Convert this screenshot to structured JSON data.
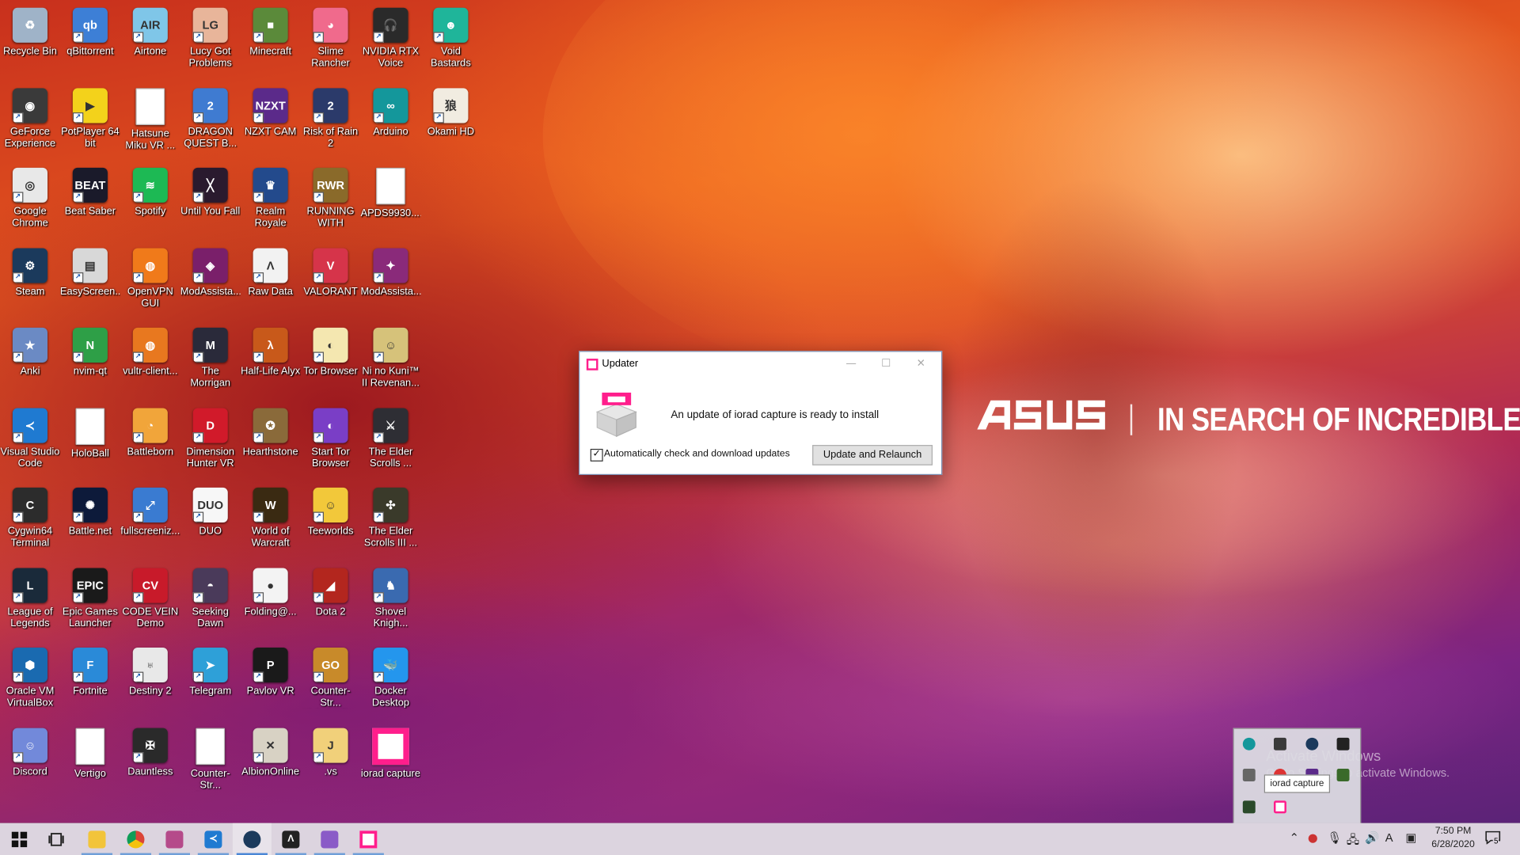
{
  "wallpaper": {
    "brand": "/ISUS",
    "slogan": "IN SEARCH OF INCREDIBLE"
  },
  "watermark": {
    "line1": "Activate Windows",
    "line2": "Go to Settings to activate Windows."
  },
  "desktop": {
    "icons": [
      {
        "label": "Recycle Bin",
        "icon": "recycle-bin-icon",
        "bg": "#9fb3c8",
        "glyph": "♻",
        "shortcut": false
      },
      {
        "label": "qBittorrent",
        "icon": "qbittorrent-icon",
        "bg": "#3d7fd6",
        "glyph": "qb",
        "shortcut": true
      },
      {
        "label": "Airtone",
        "icon": "airtone-icon",
        "bg": "#7fc6e8",
        "glyph": "AIR",
        "shortcut": true
      },
      {
        "label": "Lucy Got\nProblems",
        "icon": "lucy-got-problems-icon",
        "bg": "#e8b59a",
        "glyph": "LG",
        "shortcut": true
      },
      {
        "label": "Minecraft",
        "icon": "minecraft-icon",
        "bg": "#5b8a3a",
        "glyph": "■",
        "shortcut": true
      },
      {
        "label": "Slime\nRancher",
        "icon": "slime-rancher-icon",
        "bg": "#f06a8c",
        "glyph": "◕",
        "shortcut": true
      },
      {
        "label": "NVIDIA RTX\nVoice",
        "icon": "nvidia-rtx-voice-icon",
        "bg": "#2a2a2a",
        "glyph": "🎧",
        "shortcut": true
      },
      {
        "label": "Void Bastards",
        "icon": "void-bastards-icon",
        "bg": "#1fb59a",
        "glyph": "☻",
        "shortcut": true
      },
      {
        "label": "GeForce\nExperience",
        "icon": "geforce-experience-icon",
        "bg": "#3a3a3a",
        "glyph": "◉",
        "shortcut": true
      },
      {
        "label": "PotPlayer 64\nbit",
        "icon": "potplayer-icon",
        "bg": "#f3d21b",
        "glyph": "▶",
        "shortcut": true
      },
      {
        "label": "Hatsune\nMiku VR ...",
        "icon": "hatsune-miku-vr-icon",
        "bg": "#ffffff",
        "glyph": "",
        "shortcut": false
      },
      {
        "label": "DRAGON\nQUEST B...",
        "icon": "dragon-quest-builders-icon",
        "bg": "#3f7bd1",
        "glyph": "2",
        "shortcut": true
      },
      {
        "label": "NZXT CAM",
        "icon": "nzxt-cam-icon",
        "bg": "#5b2a8a",
        "glyph": "NZXT",
        "shortcut": true
      },
      {
        "label": "Risk of Rain 2",
        "icon": "risk-of-rain-2-icon",
        "bg": "#2b3a6a",
        "glyph": "2",
        "shortcut": true
      },
      {
        "label": "Arduino",
        "icon": "arduino-icon",
        "bg": "#14979b",
        "glyph": "∞",
        "shortcut": true
      },
      {
        "label": "Okami HD",
        "icon": "okami-hd-icon",
        "bg": "#f1ece1",
        "glyph": "狼",
        "shortcut": true
      },
      {
        "label": "Google\nChrome",
        "icon": "google-chrome-icon",
        "bg": "#e8e8e8",
        "glyph": "◎",
        "shortcut": true
      },
      {
        "label": "Beat Saber",
        "icon": "beat-saber-icon",
        "bg": "#1a1a2a",
        "glyph": "BEAT",
        "shortcut": true
      },
      {
        "label": "Spotify",
        "icon": "spotify-icon",
        "bg": "#1db954",
        "glyph": "≋",
        "shortcut": true
      },
      {
        "label": "Until You Fall",
        "icon": "until-you-fall-icon",
        "bg": "#2a1a2e",
        "glyph": "╳",
        "shortcut": true
      },
      {
        "label": "Realm Royale",
        "icon": "realm-royale-icon",
        "bg": "#234a8c",
        "glyph": "♛",
        "shortcut": true
      },
      {
        "label": "RUNNING\nWITH RIFLES",
        "icon": "running-with-rifles-icon",
        "bg": "#8a6a2a",
        "glyph": "RWR",
        "shortcut": true
      },
      {
        "label": "APDS9930....",
        "icon": "apds9930-file-icon",
        "bg": "#ffffff",
        "glyph": "",
        "shortcut": false
      },
      {
        "label": "",
        "icon": "empty-slot",
        "bg": "transparent",
        "glyph": "",
        "shortcut": false
      },
      {
        "label": "Steam",
        "icon": "steam-icon",
        "bg": "#1b3a5c",
        "glyph": "⚙",
        "shortcut": true
      },
      {
        "label": "EasyScreen...",
        "icon": "easyscreen-icon",
        "bg": "#d8d8d8",
        "glyph": "▤",
        "shortcut": true
      },
      {
        "label": "OpenVPN\nGUI",
        "icon": "openvpn-gui-icon",
        "bg": "#f07a1a",
        "glyph": "◍",
        "shortcut": true
      },
      {
        "label": "ModAssista...",
        "icon": "modassistant-icon",
        "bg": "#7a1f6a",
        "glyph": "◈",
        "shortcut": true
      },
      {
        "label": "Raw Data",
        "icon": "raw-data-icon",
        "bg": "#f2f2f2",
        "glyph": "Λ",
        "shortcut": true
      },
      {
        "label": "VALORANT",
        "icon": "valorant-icon",
        "bg": "#d6344a",
        "glyph": "V",
        "shortcut": true
      },
      {
        "label": "ModAssista...",
        "icon": "modassistant-2-icon",
        "bg": "#8a2a7a",
        "glyph": "✦",
        "shortcut": true
      },
      {
        "label": "",
        "icon": "empty-slot",
        "bg": "transparent",
        "glyph": "",
        "shortcut": false
      },
      {
        "label": "Anki",
        "icon": "anki-icon",
        "bg": "#6b8ac4",
        "glyph": "★",
        "shortcut": true
      },
      {
        "label": "nvim-qt",
        "icon": "nvim-qt-icon",
        "bg": "#2e9f47",
        "glyph": "N",
        "shortcut": true
      },
      {
        "label": "vultr-client...",
        "icon": "vultr-client-icon",
        "bg": "#e8781f",
        "glyph": "◍",
        "shortcut": true
      },
      {
        "label": "The Morrigan",
        "icon": "the-morrigan-icon",
        "bg": "#2a2a3a",
        "glyph": "M",
        "shortcut": true
      },
      {
        "label": "Half-Life Alyx",
        "icon": "half-life-alyx-icon",
        "bg": "#c8591a",
        "glyph": "λ",
        "shortcut": true
      },
      {
        "label": "Tor Browser",
        "icon": "tor-browser-icon",
        "bg": "#f4e7b0",
        "glyph": "◐",
        "shortcut": true
      },
      {
        "label": "Ni no Kuni™\nII Revenan...",
        "icon": "ni-no-kuni-icon",
        "bg": "#d6c27a",
        "glyph": "☺",
        "shortcut": true
      },
      {
        "label": "",
        "icon": "empty-slot",
        "bg": "transparent",
        "glyph": "",
        "shortcut": false
      },
      {
        "label": "Visual Studio\nCode",
        "icon": "visual-studio-code-icon",
        "bg": "#1f7ad1",
        "glyph": "≺",
        "shortcut": true
      },
      {
        "label": "HoloBall",
        "icon": "holoball-file-icon",
        "bg": "#ffffff",
        "glyph": "",
        "shortcut": false
      },
      {
        "label": "Battleborn",
        "icon": "battleborn-icon",
        "bg": "#f1a53a",
        "glyph": "◔",
        "shortcut": true
      },
      {
        "label": "Dimension\nHunter VR",
        "icon": "dimension-hunter-vr-icon",
        "bg": "#d11a2a",
        "glyph": "D",
        "shortcut": true
      },
      {
        "label": "Hearthstone",
        "icon": "hearthstone-icon",
        "bg": "#8a6a3a",
        "glyph": "✪",
        "shortcut": true
      },
      {
        "label": "Start Tor\nBrowser",
        "icon": "start-tor-browser-icon",
        "bg": "#7a3ec6",
        "glyph": "◐",
        "shortcut": true
      },
      {
        "label": "The Elder\nScrolls ...",
        "icon": "elder-scrolls-icon",
        "bg": "#2e2e34",
        "glyph": "⚔",
        "shortcut": true
      },
      {
        "label": "",
        "icon": "empty-slot",
        "bg": "transparent",
        "glyph": "",
        "shortcut": false
      },
      {
        "label": "Cygwin64\nTerminal",
        "icon": "cygwin64-terminal-icon",
        "bg": "#2c2c2c",
        "glyph": "C",
        "shortcut": true
      },
      {
        "label": "Battle.net",
        "icon": "battle-net-icon",
        "bg": "#0d1a3a",
        "glyph": "✺",
        "shortcut": true
      },
      {
        "label": "fullscreeniz...",
        "icon": "fullscreenizer-icon",
        "bg": "#3a7bd1",
        "glyph": "⤢",
        "shortcut": true
      },
      {
        "label": "DUO",
        "icon": "duo-icon",
        "bg": "#f7f7f7",
        "glyph": "DUO",
        "shortcut": true
      },
      {
        "label": "World of\nWarcraft",
        "icon": "world-of-warcraft-icon",
        "bg": "#3a2a12",
        "glyph": "W",
        "shortcut": true
      },
      {
        "label": "Teeworlds",
        "icon": "teeworlds-icon",
        "bg": "#f2c83a",
        "glyph": "☺",
        "shortcut": true
      },
      {
        "label": "The Elder\nScrolls III ...",
        "icon": "elder-scrolls-3-icon",
        "bg": "#3a3a2a",
        "glyph": "✣",
        "shortcut": true
      },
      {
        "label": "",
        "icon": "empty-slot",
        "bg": "transparent",
        "glyph": "",
        "shortcut": false
      },
      {
        "label": "League of\nLegends",
        "icon": "league-of-legends-icon",
        "bg": "#1a2a3a",
        "glyph": "L",
        "shortcut": true
      },
      {
        "label": "Epic Games\nLauncher",
        "icon": "epic-games-launcher-icon",
        "bg": "#1a1a1a",
        "glyph": "EPIC",
        "shortcut": true
      },
      {
        "label": "CODE VEIN\nDemo",
        "icon": "code-vein-demo-icon",
        "bg": "#c81a2a",
        "glyph": "CV",
        "shortcut": true
      },
      {
        "label": "Seeking\nDawn",
        "icon": "seeking-dawn-icon",
        "bg": "#4a3a5a",
        "glyph": "◓",
        "shortcut": true
      },
      {
        "label": "Folding@...",
        "icon": "folding-at-home-icon",
        "bg": "#f3f3f3",
        "glyph": "●",
        "shortcut": true
      },
      {
        "label": "Dota 2",
        "icon": "dota-2-icon",
        "bg": "#b3261e",
        "glyph": "◢",
        "shortcut": true
      },
      {
        "label": "Shovel\nKnigh...",
        "icon": "shovel-knight-icon",
        "bg": "#3a6ab0",
        "glyph": "♞",
        "shortcut": true
      },
      {
        "label": "",
        "icon": "empty-slot",
        "bg": "transparent",
        "glyph": "",
        "shortcut": false
      },
      {
        "label": "Oracle VM\nVirtualBox",
        "icon": "oracle-vm-virtualbox-icon",
        "bg": "#1a6ab0",
        "glyph": "⬢",
        "shortcut": true
      },
      {
        "label": "Fortnite",
        "icon": "fortnite-icon",
        "bg": "#2a8ad8",
        "glyph": "F",
        "shortcut": true
      },
      {
        "label": "Destiny 2",
        "icon": "destiny-2-icon",
        "bg": "#e8e8e8",
        "glyph": "♅",
        "shortcut": true
      },
      {
        "label": "Telegram",
        "icon": "telegram-icon",
        "bg": "#2ea0d8",
        "glyph": "➤",
        "shortcut": true
      },
      {
        "label": "Pavlov VR",
        "icon": "pavlov-vr-icon",
        "bg": "#1a1a1a",
        "glyph": "P",
        "shortcut": true
      },
      {
        "label": "Counter-Str...\nGlobal Offe...",
        "icon": "counter-strike-go-icon",
        "bg": "#c88a2a",
        "glyph": "GO",
        "shortcut": true
      },
      {
        "label": "Docker\nDesktop",
        "icon": "docker-desktop-icon",
        "bg": "#2496ed",
        "glyph": "🐳",
        "shortcut": true
      },
      {
        "label": "",
        "icon": "empty-slot",
        "bg": "transparent",
        "glyph": "",
        "shortcut": false
      },
      {
        "label": "Discord",
        "icon": "discord-icon",
        "bg": "#7289da",
        "glyph": "☺",
        "shortcut": true
      },
      {
        "label": "Vertigo",
        "icon": "vertigo-file-icon",
        "bg": "#ffffff",
        "glyph": "",
        "shortcut": false
      },
      {
        "label": "Dauntless",
        "icon": "dauntless-icon",
        "bg": "#2a2a2a",
        "glyph": "✠",
        "shortcut": true
      },
      {
        "label": "Counter-Str...\nSource",
        "icon": "counter-strike-source-file-icon",
        "bg": "#ffffff",
        "glyph": "",
        "shortcut": false
      },
      {
        "label": "AlbionOnline",
        "icon": "albion-online-icon",
        "bg": "#d8d2c4",
        "glyph": "✕",
        "shortcut": true
      },
      {
        "label": ".vs",
        "icon": "vs-folder-icon",
        "bg": "#f1d07a",
        "glyph": "J",
        "shortcut": true
      },
      {
        "label": "iorad capture",
        "icon": "iorad-capture-icon",
        "bg": "#ff1e8c",
        "glyph": "□",
        "shortcut": false
      },
      {
        "label": "",
        "icon": "empty-slot",
        "bg": "transparent",
        "glyph": "",
        "shortcut": false
      }
    ]
  },
  "dialog": {
    "title": "Updater",
    "minimize_glyph": "—",
    "maximize_glyph": "☐",
    "close_glyph": "✕",
    "message": "An update of iorad capture is ready to install",
    "checkbox_checked": true,
    "checkbox_glyph": "✓",
    "checkbox_label": "Automatically check and download updates",
    "button_label": "Update and Relaunch"
  },
  "tray_flyout": {
    "tooltip": "iorad capture",
    "icons": [
      "arduino-tray-icon",
      "windows-security-tray-icon",
      "steam-tray-icon",
      "epic-tray-icon",
      "network-tray-icon",
      "red-app-tray-icon",
      "nzxt-tray-icon",
      "gpu-tray-icon",
      "nvidia-tray-icon",
      "iorad-tray-icon"
    ]
  },
  "taskbar": {
    "items": [
      "start-button",
      "task-view-button",
      "file-explorer-button",
      "chrome-button",
      "screen-tool-button",
      "vscode-button",
      "steam-button",
      "unreal-button",
      "visual-studio-button",
      "iorad-capture-button"
    ],
    "ime": "A",
    "time": "7:50 PM",
    "date": "6/28/2020",
    "notification_count": "5",
    "colors": {
      "accent": "#4a87d6",
      "iorad": "#ff1e8c",
      "taskbar_bg": "#dcd4df"
    }
  }
}
